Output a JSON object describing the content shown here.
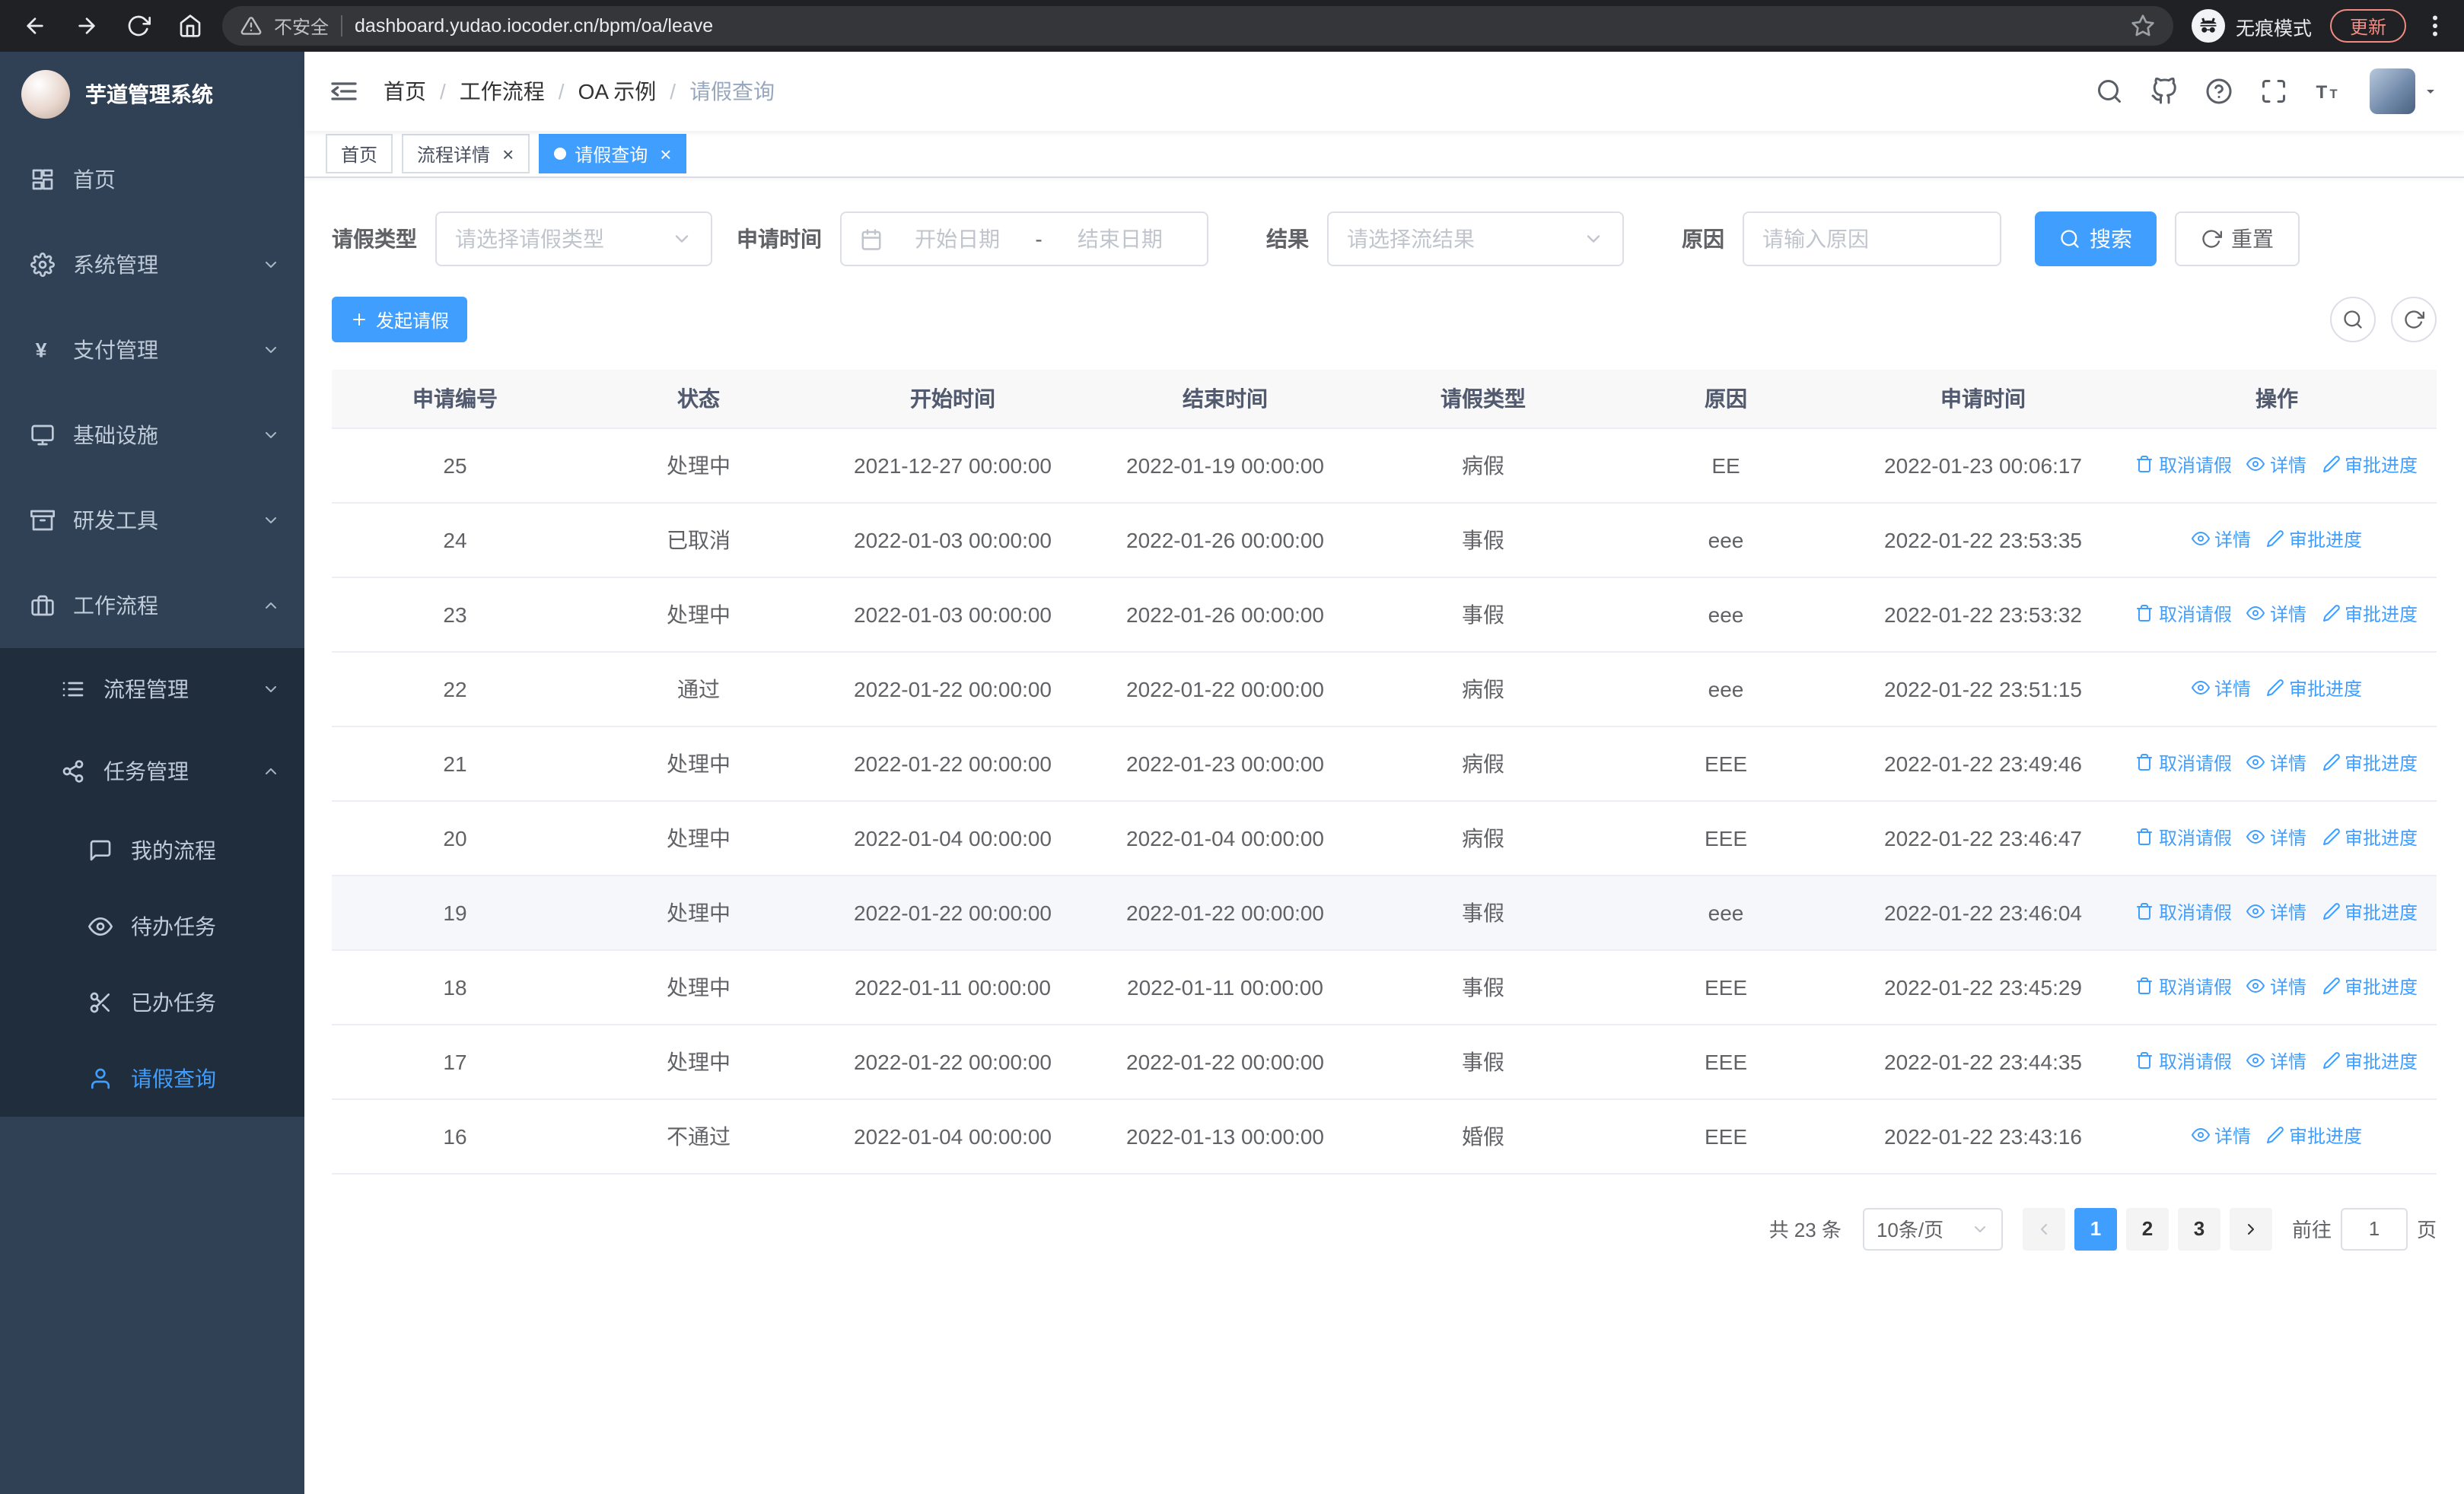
{
  "browser": {
    "url": "dashboard.yudao.iocoder.cn/bpm/oa/leave",
    "security_warning": "不安全",
    "incognito_label": "无痕模式",
    "update_label": "更新"
  },
  "sidebar": {
    "app_title": "芋道管理系统",
    "items": [
      {
        "key": "home",
        "label": "首页",
        "icon": "dashboard",
        "level": 1
      },
      {
        "key": "system",
        "label": "系统管理",
        "icon": "gear",
        "level": 1,
        "chevron": "down"
      },
      {
        "key": "payment",
        "label": "支付管理",
        "icon": "yen",
        "level": 1,
        "chevron": "down"
      },
      {
        "key": "infrastructure",
        "label": "基础设施",
        "icon": "monitor",
        "level": 1,
        "chevron": "down"
      },
      {
        "key": "devtools",
        "label": "研发工具",
        "icon": "archive",
        "level": 1,
        "chevron": "down"
      },
      {
        "key": "workflow",
        "label": "工作流程",
        "icon": "briefcase",
        "level": 1,
        "chevron": "up"
      },
      {
        "key": "process-mgmt",
        "label": "流程管理",
        "icon": "list",
        "level": 2,
        "chevron": "down"
      },
      {
        "key": "task-mgmt",
        "label": "任务管理",
        "icon": "share",
        "level": 2,
        "chevron": "up"
      },
      {
        "key": "my-process",
        "label": "我的流程",
        "icon": "chat",
        "level": 3
      },
      {
        "key": "todo-tasks",
        "label": "待办任务",
        "icon": "eye",
        "level": 3
      },
      {
        "key": "done-tasks",
        "label": "已办任务",
        "icon": "scissors",
        "level": 3
      },
      {
        "key": "leave-query",
        "label": "请假查询",
        "icon": "user",
        "level": 3,
        "active": true
      }
    ]
  },
  "header": {
    "breadcrumb": [
      "首页",
      "工作流程",
      "OA 示例",
      "请假查询"
    ],
    "tools": [
      {
        "icon": "search"
      },
      {
        "icon": "github"
      },
      {
        "icon": "help"
      },
      {
        "icon": "fullscreen"
      },
      {
        "icon": "font-size"
      }
    ]
  },
  "tabs": [
    {
      "key": "home",
      "label": "首页",
      "closable": false,
      "active": false
    },
    {
      "key": "process-detail",
      "label": "流程详情",
      "closable": true,
      "active": false
    },
    {
      "key": "leave-query",
      "label": "请假查询",
      "closable": true,
      "active": true
    }
  ],
  "filters": {
    "leave_type_label": "请假类型",
    "leave_type_placeholder": "请选择请假类型",
    "apply_time_label": "申请时间",
    "start_date_placeholder": "开始日期",
    "range_separator": "-",
    "end_date_placeholder": "结束日期",
    "result_label": "结果",
    "result_placeholder": "请选择流结果",
    "reason_label": "原因",
    "reason_placeholder": "请输入原因",
    "search_label": "搜索",
    "reset_label": "重置"
  },
  "toolbar": {
    "create_label": "发起请假"
  },
  "table": {
    "columns": [
      "申请编号",
      "状态",
      "开始时间",
      "结束时间",
      "请假类型",
      "原因",
      "申请时间",
      "操作"
    ],
    "action_defs": {
      "cancel": {
        "name": "action-cancel-leave",
        "icon": "delete",
        "label": "取消请假"
      },
      "view": {
        "name": "action-detail",
        "icon": "eye",
        "label": "详情"
      },
      "progress": {
        "name": "action-approval-progress",
        "icon": "edit",
        "label": "审批进度"
      }
    },
    "rows": [
      {
        "id": "25",
        "status": "处理中",
        "start": "2021-12-27 00:00:00",
        "end": "2022-01-19 00:00:00",
        "type": "病假",
        "reason": "EE",
        "applied": "2022-01-23 00:06:17",
        "actions": [
          "cancel",
          "view",
          "progress"
        ]
      },
      {
        "id": "24",
        "status": "已取消",
        "start": "2022-01-03 00:00:00",
        "end": "2022-01-26 00:00:00",
        "type": "事假",
        "reason": "eee",
        "applied": "2022-01-22 23:53:35",
        "actions": [
          "view",
          "progress"
        ]
      },
      {
        "id": "23",
        "status": "处理中",
        "start": "2022-01-03 00:00:00",
        "end": "2022-01-26 00:00:00",
        "type": "事假",
        "reason": "eee",
        "applied": "2022-01-22 23:53:32",
        "actions": [
          "cancel",
          "view",
          "progress"
        ]
      },
      {
        "id": "22",
        "status": "通过",
        "start": "2022-01-22 00:00:00",
        "end": "2022-01-22 00:00:00",
        "type": "病假",
        "reason": "eee",
        "applied": "2022-01-22 23:51:15",
        "actions": [
          "view",
          "progress"
        ]
      },
      {
        "id": "21",
        "status": "处理中",
        "start": "2022-01-22 00:00:00",
        "end": "2022-01-23 00:00:00",
        "type": "病假",
        "reason": "EEE",
        "applied": "2022-01-22 23:49:46",
        "actions": [
          "cancel",
          "view",
          "progress"
        ]
      },
      {
        "id": "20",
        "status": "处理中",
        "start": "2022-01-04 00:00:00",
        "end": "2022-01-04 00:00:00",
        "type": "病假",
        "reason": "EEE",
        "applied": "2022-01-22 23:46:47",
        "actions": [
          "cancel",
          "view",
          "progress"
        ]
      },
      {
        "id": "19",
        "status": "处理中",
        "start": "2022-01-22 00:00:00",
        "end": "2022-01-22 00:00:00",
        "type": "事假",
        "reason": "eee",
        "applied": "2022-01-22 23:46:04",
        "actions": [
          "cancel",
          "view",
          "progress"
        ],
        "highlight": true
      },
      {
        "id": "18",
        "status": "处理中",
        "start": "2022-01-11 00:00:00",
        "end": "2022-01-11 00:00:00",
        "type": "事假",
        "reason": "EEE",
        "applied": "2022-01-22 23:45:29",
        "actions": [
          "cancel",
          "view",
          "progress"
        ]
      },
      {
        "id": "17",
        "status": "处理中",
        "start": "2022-01-22 00:00:00",
        "end": "2022-01-22 00:00:00",
        "type": "事假",
        "reason": "EEE",
        "applied": "2022-01-22 23:44:35",
        "actions": [
          "cancel",
          "view",
          "progress"
        ]
      },
      {
        "id": "16",
        "status": "不通过",
        "start": "2022-01-04 00:00:00",
        "end": "2022-01-13 00:00:00",
        "type": "婚假",
        "reason": "EEE",
        "applied": "2022-01-22 23:43:16",
        "actions": [
          "view",
          "progress"
        ]
      }
    ]
  },
  "pagination": {
    "total_label": "共 23 条",
    "page_size": "10条/页",
    "pages": [
      "1",
      "2",
      "3"
    ],
    "active_page": "1",
    "goto_label": "前往",
    "goto_value": "1",
    "page_unit": "页"
  },
  "colors": {
    "primary": "#409eff",
    "sidebar_bg": "#304156",
    "submenu_bg": "#1f2d3d",
    "update_chip": "#f28b82"
  }
}
